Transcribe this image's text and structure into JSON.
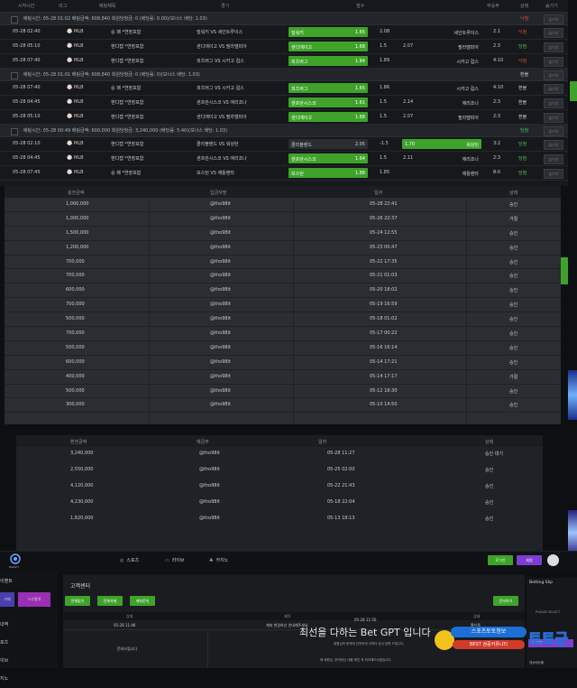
{
  "bets": {
    "header": {
      "start": "시작시간",
      "league": "리그",
      "type": "배팅제목",
      "match": "경기",
      "score": "점수",
      "winlose": "무승부",
      "status": "상태",
      "close": "숨기기"
    },
    "groups": [
      {
        "info": "배팅시간: 05-28 01:02  배팅금액: 608,840  회원당첨금: 0  (배당률: 0.00)(보너스 배당: 1.03)",
        "status": "낙첨",
        "status_kind": "cash",
        "rows": [
          {
            "time": "05-28 02:40",
            "league": "MLB",
            "type": "승 패 *연장포함",
            "home": "밀워키 VS 세인트루이스",
            "pick1": "밀워키",
            "o1": "1.65",
            "mid": "2.08",
            "pick2": "세인트루이스",
            "o2": "2.1",
            "state": "낙첨",
            "sel": 1,
            "state_kind": "cash"
          },
          {
            "time": "05-28 05:10",
            "league": "MLB",
            "type": "핸디캡 *연장포함",
            "home": "샌디에이고 VS 필라델피아",
            "pick1": "샌디에이고",
            "o1": "1.68",
            "mid": "1.5",
            "mid2": "2.07",
            "pick2": "필라델피아",
            "o2": "2.3",
            "state": "당첨",
            "sel": 1,
            "state_kind": "win"
          },
          {
            "time": "05-28 07:40",
            "league": "MLB",
            "type": "핸디캡 *연장포함",
            "home": "피츠버그 VS 시카고 컵스",
            "pick1": "피츠버그",
            "o1": "1.84",
            "mid": "1.89",
            "pick2": "시카고 컵스",
            "o2": "4:10",
            "state": "낙첨",
            "sel": 1,
            "state_kind": "cash"
          }
        ]
      },
      {
        "info": "배팅시간: 05-28 01:01  배팅금액: 608,840  회원당첨금: 0  (배당률: 0)(보너스 배당: 1.03)",
        "status": "환불",
        "status_kind": "refund",
        "rows": [
          {
            "time": "05-28 07:40",
            "league": "MLB",
            "type": "승 패 *연장포함",
            "home": "피츠버그 VS 시카고 컵스",
            "pick1": "피츠버그",
            "o1": "1.65",
            "mid": "1.86",
            "pick2": "시카고 컵스",
            "o2": "4:10",
            "state": "환불",
            "sel": 1,
            "state_kind": "refund"
          },
          {
            "time": "05-28 04:45",
            "league": "MLB",
            "type": "핸디캡 *연장포함",
            "home": "샌프란시스코 VS 애리조나",
            "pick1": "샌프란시스코",
            "o1": "1.61",
            "mid": "1.5",
            "mid2": "2.14",
            "pick2": "애리조나",
            "o2": "2:3",
            "state": "환불",
            "sel": 1,
            "state_kind": "refund"
          },
          {
            "time": "05-28 05:10",
            "league": "MLB",
            "type": "핸디캡 *연장포함",
            "home": "샌디에이고 VS 필라델피아",
            "pick1": "샌디에이고",
            "o1": "1.68",
            "mid": "1.5",
            "mid2": "2.07",
            "pick2": "필라델피아",
            "o2": "2:3",
            "state": "환불",
            "sel": 1,
            "state_kind": "refund"
          }
        ]
      },
      {
        "info": "배팅시간: 05-28 00:49  배팅금액: 600,000  회원당첨금: 3,240,000  (배당률: 5.40)(보너스 배당: 1.03)",
        "status": "당첨",
        "status_kind": "win",
        "rows": [
          {
            "time": "05-28 02:10",
            "league": "MLB",
            "type": "핸디캡 *연장포함",
            "home": "클리블랜드 VS 워싱턴",
            "pick1": "클리블랜드",
            "o1": "2.05",
            "mid": "-1.5",
            "pick2": "워싱턴",
            "o2b": "1.70",
            "o2": "3:2",
            "state": "당첨",
            "sel": 2,
            "state_kind": "win"
          },
          {
            "time": "05-28 04:45",
            "league": "MLB",
            "type": "핸디캡 *연장포함",
            "home": "샌프란시스코 VS 애리조나",
            "pick1": "샌프란시스코",
            "o1": "1.64",
            "mid": "1.5",
            "mid2": "2.11",
            "pick2": "애리조나",
            "o2": "2:3",
            "state": "당첨",
            "sel": 1,
            "state_kind": "win"
          },
          {
            "time": "05-28 07:45",
            "league": "MLB",
            "type": "승 패 *연장포함",
            "home": "보스턴 VS 애틀랜타",
            "pick1": "보스턴",
            "o1": "1.88",
            "mid": "1.85",
            "pick2": "애틀랜타",
            "o2": "8:0",
            "state": "당첨",
            "sel": 1,
            "state_kind": "win"
          }
        ]
      }
    ],
    "hide_label": "숨기기"
  },
  "deposits": {
    "headers": [
      "충전금액",
      "입금자명",
      "일자",
      "상태"
    ],
    "rows": [
      [
        "1,000,000",
        "@tho98it",
        "05-28 22:41",
        "승인"
      ],
      [
        "1,000,000",
        "@tho98it",
        "05-26 22:37",
        "거절"
      ],
      [
        "1,500,000",
        "@tho98it",
        "05-24 12:55",
        "승인"
      ],
      [
        "1,200,000",
        "@tho98it",
        "05-23 00:47",
        "승인"
      ],
      [
        "700,000",
        "@tho98it",
        "05-22 17:35",
        "승인"
      ],
      [
        "700,000",
        "@tho98it",
        "05-21 01:03",
        "승인"
      ],
      [
        "600,000",
        "@tho98it",
        "05-20 18:02",
        "승인"
      ],
      [
        "700,000",
        "@tho98it",
        "05-19 16:59",
        "승인"
      ],
      [
        "500,000",
        "@tho98it",
        "05-18 01:02",
        "승인"
      ],
      [
        "700,000",
        "@tho98it",
        "05-17 00:22",
        "승인"
      ],
      [
        "500,000",
        "@tho98it",
        "05-16 16:14",
        "승인"
      ],
      [
        "600,000",
        "@tho98it",
        "05-14 17:21",
        "승인"
      ],
      [
        "400,000",
        "@tho98it",
        "05-14 17:17",
        "거절"
      ],
      [
        "500,000",
        "@tho98it",
        "05-12 18:30",
        "승인"
      ],
      [
        "300,000",
        "@tho98it",
        "05-10 14:50",
        "승인"
      ]
    ]
  },
  "withdrawals": {
    "headers": [
      "환전금액",
      "예금주",
      "일자",
      "상태"
    ],
    "rows": [
      [
        "3,240,000",
        "@tho98it",
        "05-28 11:27",
        "승인 대기"
      ],
      [
        "2,550,000",
        "@tho98it",
        "05-25 02:00",
        "승인"
      ],
      [
        "4,120,000",
        "@tho98it",
        "05-22 21:43",
        "승인"
      ],
      [
        "4,230,000",
        "@tho98it",
        "05-18 22:04",
        "승인"
      ],
      [
        "1,820,000",
        "@tho98it",
        "05-13 18:13",
        "승인"
      ]
    ]
  },
  "nav": {
    "brand": "BetGPT",
    "sports": "스포츠",
    "live": "라이브",
    "casino": "카지노",
    "login": "로그인",
    "signup": "회원"
  },
  "left": {
    "event": "이벤트",
    "b1": "카페",
    "b2": "스핀룰렛",
    "items": [
      "내역",
      "포츠",
      "이브",
      "지노"
    ]
  },
  "main": {
    "title": "고객센터",
    "btns": [
      "전체읽기",
      "전체삭제",
      "계좌문의"
    ],
    "inquiry": "문의하기",
    "cols": [
      "상태",
      "제목",
      "상태"
    ],
    "row": {
      "date": "05-28 11:46",
      "title": "계좌 변경하신 안내해주세요",
      "state": "확인중"
    },
    "notice_date": "05-28 11:50",
    "headline": "최선을 다하는 Bet GPT 입니다",
    "sub1": "회원님의 문의에 안전하게 더욱더 감사 답변 드립니다.",
    "sub2": "해 회원님, 문의하신 내용 확인 후 처리해드리겠습니다.",
    "left_label": "문의드립니다"
  },
  "slip": {
    "title": "Betting Slip",
    "placeholder": "PLEASE SELECT",
    "btn": "선택해주",
    "foot": "예상배당률"
  },
  "watermark": {
    "line1": "스포츠토토정보",
    "line2": "BEST 검증커뮤니티",
    "logo": "토토군"
  }
}
